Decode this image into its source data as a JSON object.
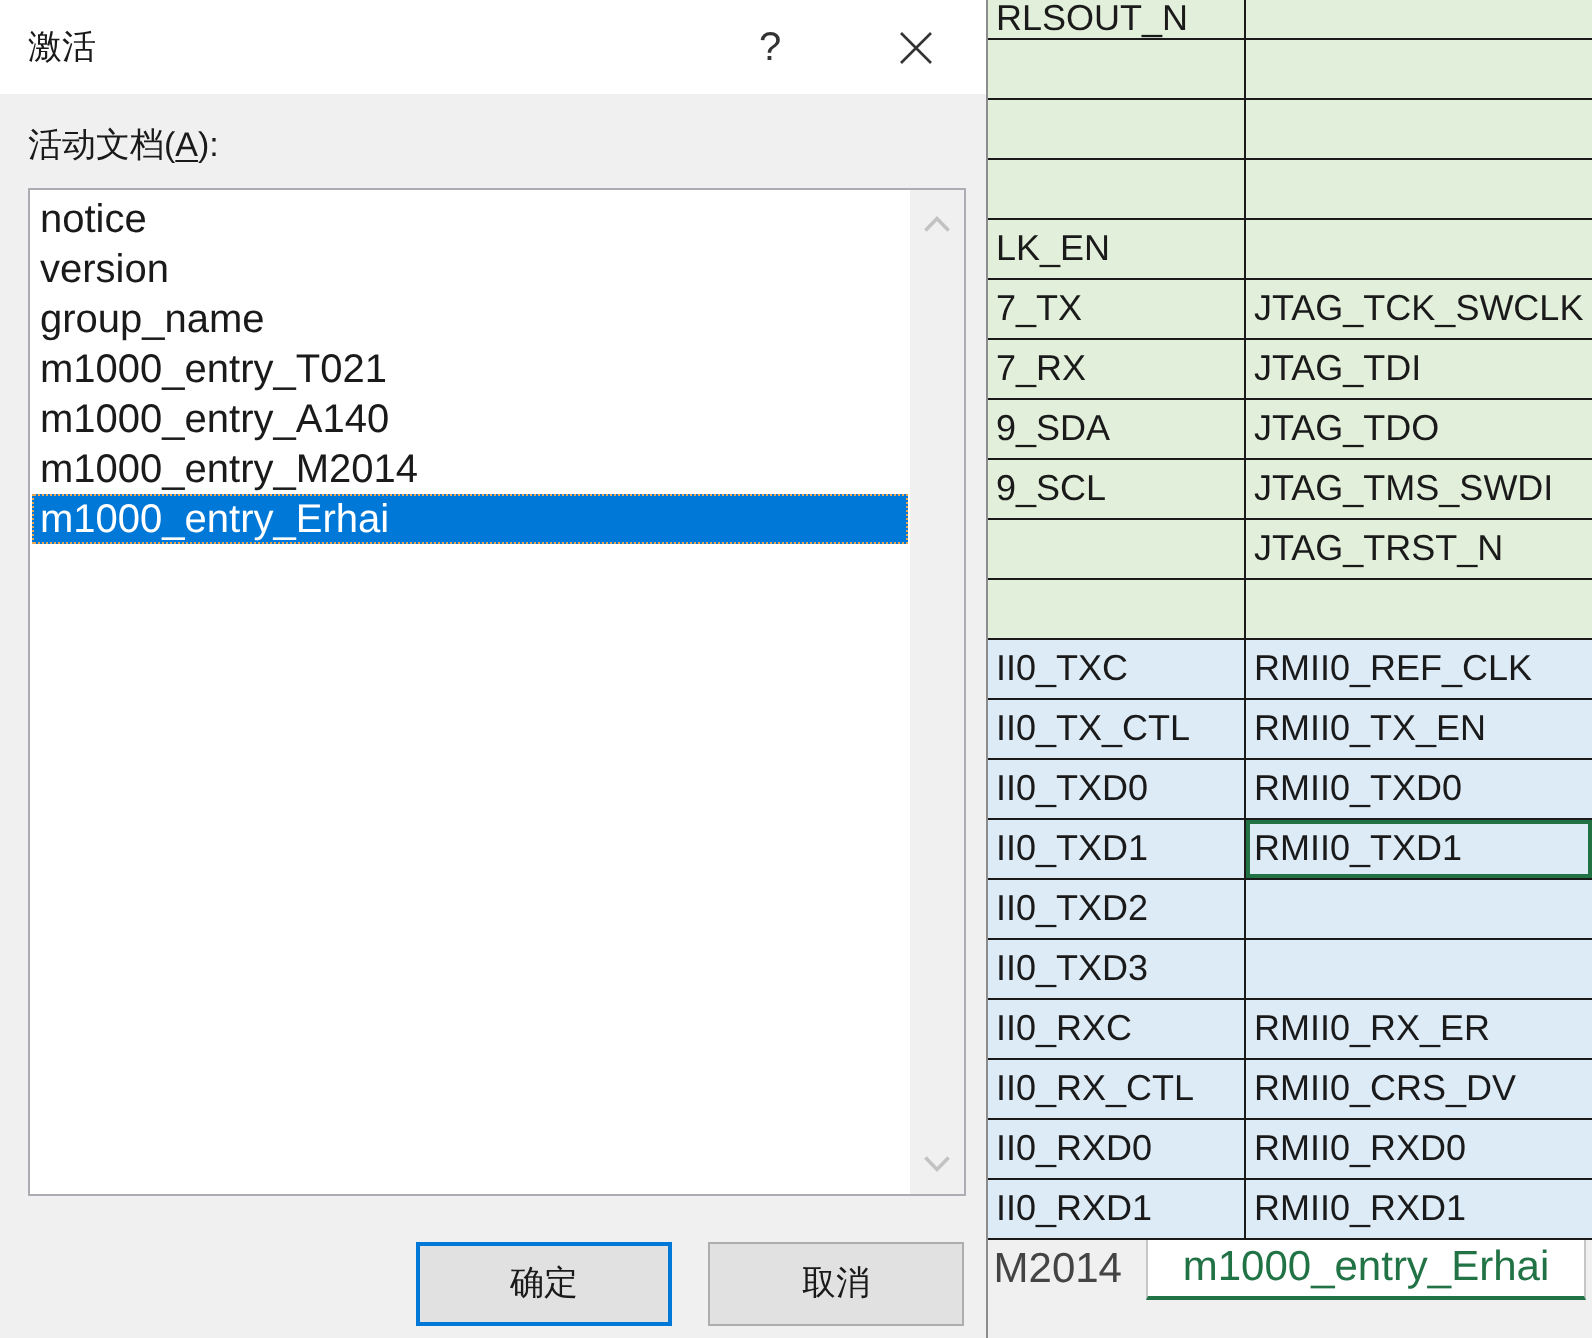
{
  "dialog": {
    "title": "激活",
    "help_button": "?",
    "label": "活动文档(A):",
    "documents": [
      {
        "name": "notice",
        "selected": false
      },
      {
        "name": "version",
        "selected": false
      },
      {
        "name": "group_name",
        "selected": false
      },
      {
        "name": "m1000_entry_T021",
        "selected": false
      },
      {
        "name": "m1000_entry_A140",
        "selected": false
      },
      {
        "name": "m1000_entry_M2014",
        "selected": false
      },
      {
        "name": "m1000_entry_Erhai",
        "selected": true
      }
    ],
    "buttons": [
      {
        "label": "确定",
        "default": true
      },
      {
        "label": "取消",
        "default": false
      }
    ]
  },
  "sheet": {
    "rows": [
      {
        "color": "#e2efda",
        "cells": [
          {
            "text": "RLSOUT_N",
            "selected": false
          },
          {
            "selected": false
          }
        ]
      },
      {
        "color": "#e2efda",
        "cells": [
          {
            "selected": false
          },
          {
            "selected": false
          }
        ]
      },
      {
        "color": "#e2efda",
        "cells": [
          {
            "selected": false
          },
          {
            "selected": false
          }
        ]
      },
      {
        "color": "#e2efda",
        "cells": [
          {
            "selected": false
          },
          {
            "selected": false
          }
        ]
      },
      {
        "color": "#e2efda",
        "cells": [
          {
            "text": "LK_EN",
            "selected": false
          },
          {
            "selected": false
          }
        ]
      },
      {
        "color": "#e2efda",
        "cells": [
          {
            "text": "7_TX",
            "selected": false
          },
          {
            "text": "JTAG_TCK_SWCLK",
            "selected": false
          }
        ]
      },
      {
        "color": "#e2efda",
        "cells": [
          {
            "text": "7_RX",
            "selected": false
          },
          {
            "text": "JTAG_TDI",
            "selected": false
          }
        ]
      },
      {
        "color": "#e2efda",
        "cells": [
          {
            "text": "9_SDA",
            "selected": false
          },
          {
            "text": "JTAG_TDO",
            "selected": false
          }
        ]
      },
      {
        "color": "#e2efda",
        "cells": [
          {
            "text": "9_SCL",
            "selected": false
          },
          {
            "text": "JTAG_TMS_SWDI",
            "selected": false
          }
        ]
      },
      {
        "color": "#e2efda",
        "cells": [
          {
            "selected": false
          },
          {
            "text": "JTAG_TRST_N",
            "selected": false
          }
        ]
      },
      {
        "color": "#e2efda",
        "cells": [
          {
            "selected": false
          },
          {
            "selected": false
          }
        ]
      },
      {
        "color": "#ddebf7",
        "cells": [
          {
            "text": "II0_TXC",
            "selected": false
          },
          {
            "text": "RMII0_REF_CLK",
            "selected": false
          }
        ]
      },
      {
        "color": "#ddebf7",
        "cells": [
          {
            "text": "II0_TX_CTL",
            "selected": false
          },
          {
            "text": "RMII0_TX_EN",
            "selected": false
          }
        ]
      },
      {
        "color": "#ddebf7",
        "cells": [
          {
            "text": "II0_TXD0",
            "selected": false
          },
          {
            "text": "RMII0_TXD0",
            "selected": false
          }
        ]
      },
      {
        "color": "#ddebf7",
        "cells": [
          {
            "text": "II0_TXD1",
            "selected": false
          },
          {
            "text": "RMII0_TXD1",
            "selected": true
          }
        ]
      },
      {
        "color": "#ddebf7",
        "cells": [
          {
            "text": "II0_TXD2",
            "selected": false
          },
          {
            "selected": false
          }
        ]
      },
      {
        "color": "#ddebf7",
        "cells": [
          {
            "text": "II0_TXD3",
            "selected": false
          },
          {
            "selected": false
          }
        ]
      },
      {
        "color": "#ddebf7",
        "cells": [
          {
            "text": "II0_RXC",
            "selected": false
          },
          {
            "text": "RMII0_RX_ER",
            "selected": false
          }
        ]
      },
      {
        "color": "#ddebf7",
        "cells": [
          {
            "text": "II0_RX_CTL",
            "selected": false
          },
          {
            "text": "RMII0_CRS_DV",
            "selected": false
          }
        ]
      },
      {
        "color": "#ddebf7",
        "cells": [
          {
            "text": "II0_RXD0",
            "selected": false
          },
          {
            "text": "RMII0_RXD0",
            "selected": false
          }
        ]
      },
      {
        "color": "#ddebf7",
        "cells": [
          {
            "text": "II0_RXD1",
            "selected": false
          },
          {
            "text": "RMII0_RXD1",
            "selected": false
          }
        ]
      }
    ]
  },
  "sheet_tabs": [
    {
      "label": "M2014",
      "selected": false
    },
    {
      "label": "m1000_entry_Erhai",
      "selected": true
    }
  ]
}
